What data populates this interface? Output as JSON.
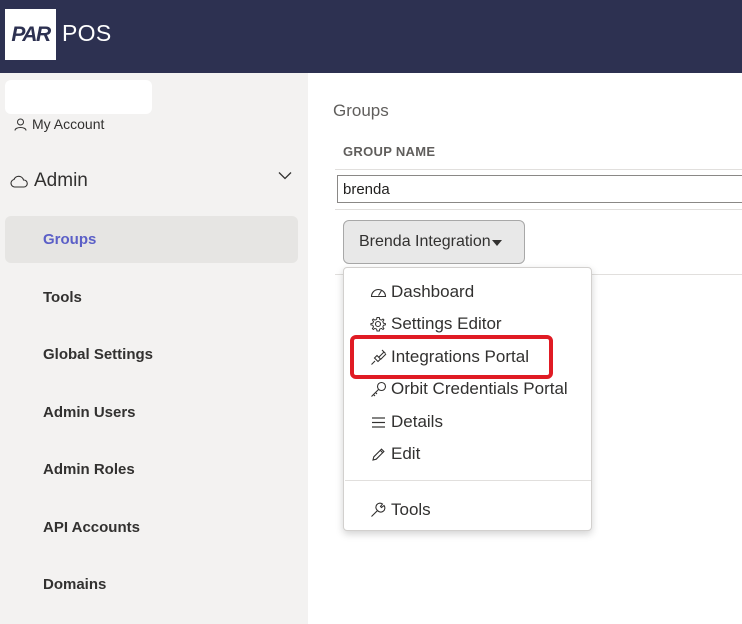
{
  "header": {
    "logo_text": "PAR",
    "app_name": "POS",
    "bg_color": "#2d3151"
  },
  "sidebar": {
    "my_account": "My Account",
    "section": "Admin",
    "items": [
      {
        "label": "Groups",
        "active": true
      },
      {
        "label": "Tools"
      },
      {
        "label": "Global Settings"
      },
      {
        "label": "Admin Users"
      },
      {
        "label": "Admin Roles"
      },
      {
        "label": "API Accounts"
      },
      {
        "label": "Domains"
      }
    ]
  },
  "main": {
    "title": "Groups",
    "column_header": "GROUP NAME",
    "filter_value": "brenda",
    "group_button": "Brenda Integration"
  },
  "menu": {
    "items": [
      {
        "label": "Dashboard",
        "icon": "gauge-icon"
      },
      {
        "label": "Settings Editor",
        "icon": "gear-icon"
      },
      {
        "label": "Integrations Portal",
        "icon": "plug-icon",
        "highlighted": true
      },
      {
        "label": "Orbit Credentials Portal",
        "icon": "key-icon"
      },
      {
        "label": "Details",
        "icon": "list-icon"
      },
      {
        "label": "Edit",
        "icon": "pencil-icon"
      },
      {
        "label": "Tools",
        "icon": "wrench-icon"
      }
    ],
    "highlight_color": "#e01b24",
    "active_color": "#5b5fc7"
  }
}
